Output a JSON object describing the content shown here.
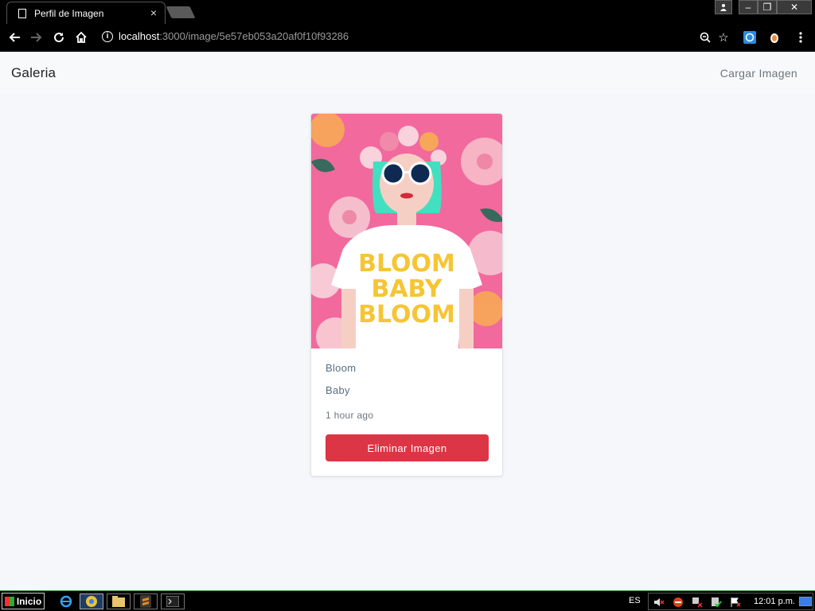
{
  "browser": {
    "tab_title": "Perfil de Imagen",
    "tab_close": "×",
    "url_host": "localhost",
    "url_path": ":3000/image/5e57eb053a20af0f10f93286",
    "window_controls": [
      "‒",
      "❐",
      "✕"
    ]
  },
  "navbar": {
    "brand": "Galeria",
    "upload_link": "Cargar Imagen"
  },
  "card": {
    "image_alt": "Bloom Baby Bloom illustration",
    "image_text_lines": [
      "BLOOM",
      "BABY",
      "BLOOM"
    ],
    "title": "Bloom",
    "description": "Baby",
    "timestamp": "1 hour ago",
    "delete_button": "Eliminar Imagen"
  },
  "taskbar": {
    "start_label": "Inicio",
    "language": "ES",
    "clock": "12:01 p.m."
  },
  "colors": {
    "danger": "#dc3545",
    "page_bg": "#f5f7fa",
    "image_bg": "#f2699e"
  }
}
